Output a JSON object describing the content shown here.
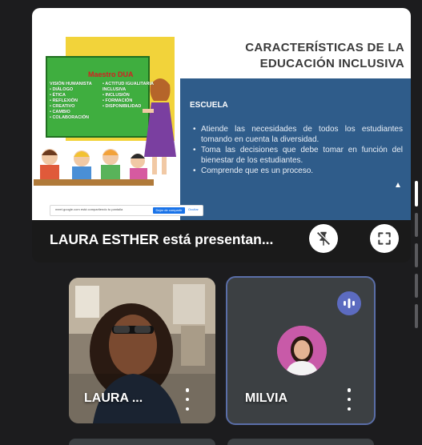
{
  "slide": {
    "title": "CARACTERÍSTICAS DE LA\nEDUCACIÓN INCLUSIVA",
    "heading": "ESCUELA",
    "bullets": [
      "Atiende las necesidades de todos los estudiantes tomando en cuenta la diversidad.",
      "Toma las decisiones que debe tomar en función del bienestar de los estudiantes.",
      "Comprende que es un proceso."
    ],
    "illustration": {
      "title": "Maestro DUA",
      "col_left": "VISIÓN HUMANISTA\n• DIÁLOGO\n• ÉTICA\n• REFLEXIÓN\n• CREATIVO\n• CAMBIO\n• COLABORACIÓN",
      "col_right": "• ACTITUD IGUALITARIA\nINCLUSIVA\n• INCLUSIÓN\n• FORMACIÓN\n• DISPONIBILIDAD"
    },
    "share_bar": {
      "text": "meet.google.com está compartiendo tu pantalla",
      "button": "Dejar de compartir",
      "hide": "Ocultar"
    }
  },
  "presentation": {
    "presenter_label": "LAURA ESTHER está presentan..."
  },
  "icons": {
    "unpin": "unpin-icon",
    "fullscreen": "fullscreen-icon",
    "audio": "audio-wave-icon",
    "more": "more-vert-icon"
  },
  "participants": [
    {
      "name": "LAURA ..."
    },
    {
      "name": "MILVIA"
    }
  ],
  "colors": {
    "background": "#1c1c1e",
    "slide_blue": "#2f5c8a",
    "tile": "#3c4043",
    "active_speaker_border": "#5a6ea8",
    "audio_badge": "#5c6bc0"
  }
}
